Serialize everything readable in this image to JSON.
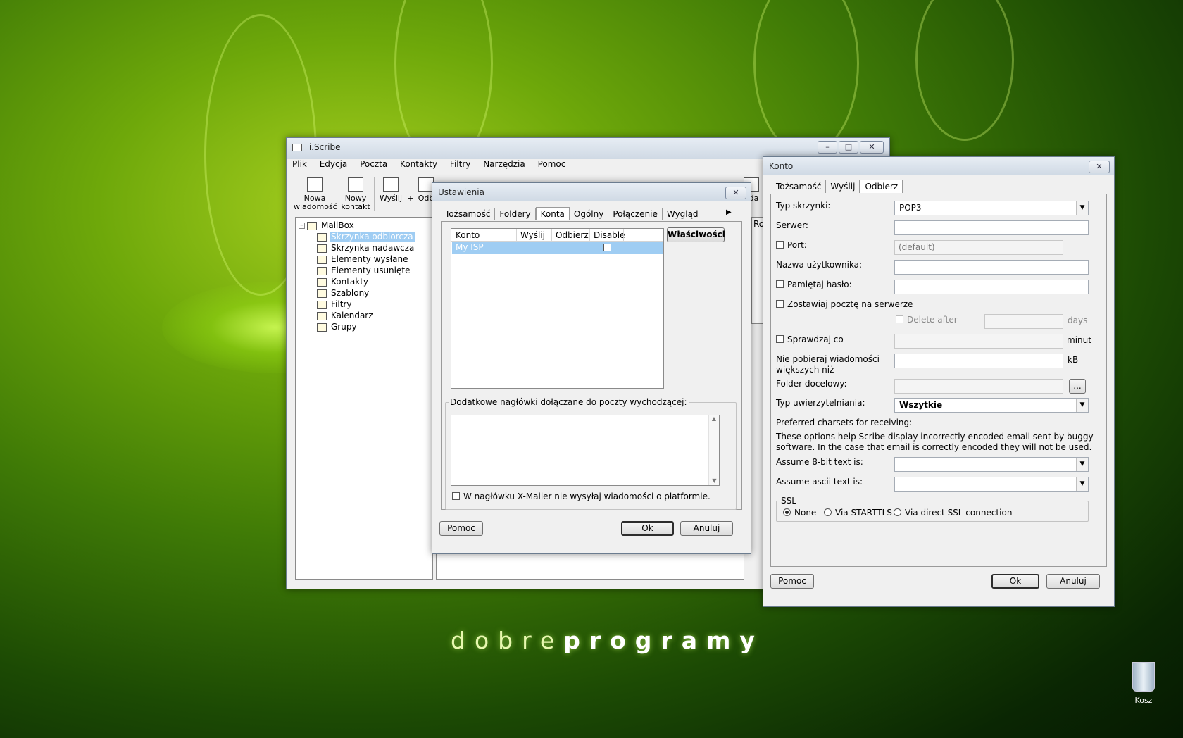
{
  "desktop": {
    "brand_light": "dobre",
    "brand_bold": "programy",
    "recycle_bin_label": "Kosz"
  },
  "main_window": {
    "title": "i.Scribe",
    "menu": [
      "Plik",
      "Edycja",
      "Poczta",
      "Kontakty",
      "Filtry",
      "Narzędzia",
      "Pomoc"
    ],
    "toolbar": {
      "new_message_l1": "Nowa",
      "new_message_l2": "wiadomość",
      "new_contact_l1": "Nowy",
      "new_contact_l2": "kontakt",
      "send": "Wyślij",
      "plus": "+",
      "receive_partial": "Odb",
      "calendar_partial": "nda"
    },
    "tree": {
      "root": "MailBox",
      "items": [
        "Skrzynka odbiorcza",
        "Skrzynka nadawcza",
        "Elementy wysłane",
        "Elementy usunięte",
        "Kontakty",
        "Szablony",
        "Filtry",
        "Kalendarz",
        "Grupy"
      ]
    },
    "list_header_partial": "Roz"
  },
  "settings_dialog": {
    "title": "Ustawienia",
    "tabs": [
      "Tożsamość",
      "Foldery",
      "Konta",
      "Ogólny",
      "Połączenie",
      "Wygląd"
    ],
    "accounts": {
      "columns": [
        "Konto",
        "Wyślij",
        "Odbierz",
        "Disable"
      ],
      "rows": [
        {
          "name": "My ISP"
        }
      ]
    },
    "properties_button": "Właściwości",
    "headers_group": "Dodatkowe nagłówki dołączane do poczty wychodzącej:",
    "xmailer_checkbox": "W nagłówku X-Mailer nie wysyłaj wiadomości o platformie.",
    "help_button": "Pomoc",
    "ok_button": "Ok",
    "cancel_button": "Anuluj"
  },
  "account_dialog": {
    "title": "Konto",
    "tabs": [
      "Tożsamość",
      "Wyślij",
      "Odbierz"
    ],
    "fields": {
      "mailbox_type_label": "Typ skrzynki:",
      "mailbox_type_value": "POP3",
      "server_label": "Serwer:",
      "server_value": "",
      "port_label": "Port:",
      "port_value": "(default)",
      "username_label": "Nazwa użytkownika:",
      "remember_password_label": "Pamiętaj hasło:",
      "leave_on_server_label": "Zostawiaj pocztę na serwerze",
      "delete_after_label": "Delete after",
      "days_unit": "days",
      "check_every_label": "Sprawdzaj co",
      "minutes_unit": "minut",
      "max_size_label_l1": "Nie pobieraj wiadomości",
      "max_size_label_l2": "większych niż",
      "kb_unit": "kB",
      "target_folder_label": "Folder docelowy:",
      "browse_button": "...",
      "auth_type_label": "Typ uwierzytelniania:",
      "auth_type_value": "Wszytkie",
      "charsets_heading": "Preferred charsets for receiving:",
      "charsets_help_l1": "These options help Scribe display incorrectly encoded email sent by buggy",
      "charsets_help_l2": "software. In the case that email is correctly encoded they will not be used.",
      "assume_8bit_label": "Assume 8-bit text is:",
      "assume_ascii_label": "Assume ascii text is:"
    },
    "ssl": {
      "group": "SSL",
      "options": [
        "None",
        "Via STARTTLS",
        "Via direct SSL connection"
      ],
      "selected": "None"
    },
    "help_button": "Pomoc",
    "ok_button": "Ok",
    "cancel_button": "Anuluj"
  }
}
